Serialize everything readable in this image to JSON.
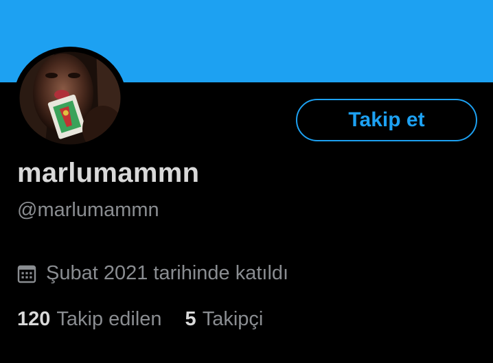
{
  "colors": {
    "banner": "#1da1f2",
    "background": "#000000",
    "accent": "#1da1f2",
    "primary_text": "#d9d9d9",
    "secondary_text": "#8a8d91"
  },
  "profile": {
    "display_name": "marlumammn",
    "handle": "@marlumammn",
    "avatar_icon": "profile-photo"
  },
  "actions": {
    "follow_label": "Takip et"
  },
  "meta": {
    "joined_icon": "calendar-icon",
    "joined_text": "Şubat 2021 tarihinde katıldı"
  },
  "stats": {
    "following_count": "120",
    "following_label": "Takip edilen",
    "followers_count": "5",
    "followers_label": "Takipçi"
  }
}
